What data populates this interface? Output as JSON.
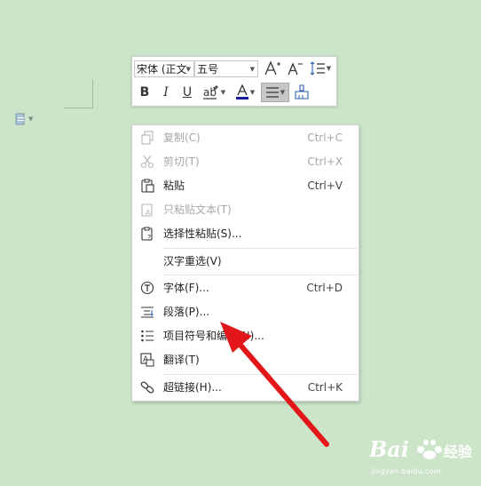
{
  "toolbar": {
    "font_name": "宋体 (正文",
    "font_size": "五号",
    "font_color": "#1a1a9c",
    "grow_font_icon": "increase-font-size-icon",
    "shrink_font_icon": "decrease-font-size-icon"
  },
  "context_menu": {
    "items": [
      {
        "label": "复制(C)",
        "shortcut": "Ctrl+C",
        "icon": "copy-icon",
        "disabled": true
      },
      {
        "label": "剪切(T)",
        "shortcut": "Ctrl+X",
        "icon": "scissors-icon",
        "disabled": true
      },
      {
        "label": "粘贴",
        "shortcut": "Ctrl+V",
        "icon": "paste-icon",
        "disabled": false
      },
      {
        "label": "只粘贴文本(T)",
        "shortcut": "",
        "icon": "paste-text-icon",
        "disabled": true
      },
      {
        "label": "选择性粘贴(S)...",
        "shortcut": "",
        "icon": "paste-special-icon",
        "disabled": false
      },
      {
        "label": "汉字重选(V)",
        "shortcut": "",
        "icon": "",
        "disabled": false
      },
      {
        "label": "字体(F)...",
        "shortcut": "Ctrl+D",
        "icon": "font-icon",
        "disabled": false
      },
      {
        "label": "段落(P)...",
        "shortcut": "",
        "icon": "paragraph-icon",
        "disabled": false
      },
      {
        "label": "项目符号和编号(N)...",
        "shortcut": "",
        "icon": "bullets-icon",
        "disabled": false
      },
      {
        "label": "翻译(T)",
        "shortcut": "",
        "icon": "translate-icon",
        "disabled": false
      },
      {
        "label": "超链接(H)...",
        "shortcut": "Ctrl+K",
        "icon": "hyperlink-icon",
        "disabled": false
      }
    ]
  },
  "annotation": {
    "arrow_color": "#e3161a"
  },
  "watermark": {
    "brand": "Bai",
    "brand_suffix": "经验",
    "url": "jingyan.baidu.com"
  }
}
